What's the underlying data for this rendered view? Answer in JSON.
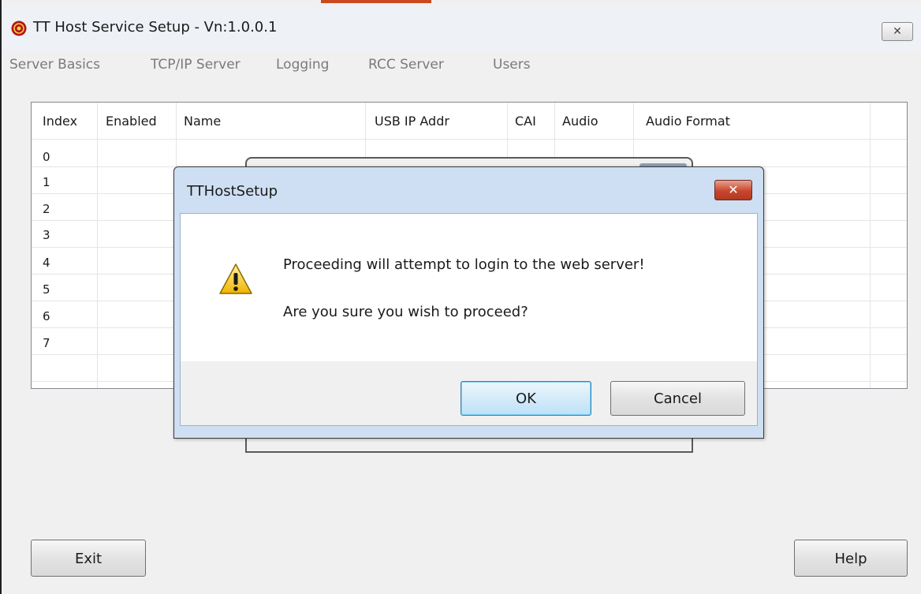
{
  "window": {
    "title": "TT Host Service Setup - Vn:1.0.0.1",
    "close_glyph": "✕"
  },
  "menu": [
    "Server Basics",
    "TCP/IP Server",
    "Logging",
    "RCC Server",
    "Users"
  ],
  "grid": {
    "columns": [
      "Index",
      "Enabled",
      "Name",
      "USB IP Addr",
      "CAI",
      "Audio",
      "Audio Format"
    ],
    "rows": [
      "0",
      "1",
      "2",
      "3",
      "4",
      "5",
      "6",
      "7"
    ]
  },
  "dialog": {
    "title": "TTHostSetup",
    "close_glyph": "✕",
    "message": "Proceeding will attempt to login to the web server!",
    "question": "Are you sure you wish to proceed?",
    "ok_label": "OK",
    "cancel_label": "Cancel",
    "icon": "warning-icon"
  },
  "buttons": {
    "exit_label": "Exit",
    "help_label": "Help"
  },
  "colors": {
    "dialog_close": "#c8462c",
    "warning": "#f5c400"
  }
}
